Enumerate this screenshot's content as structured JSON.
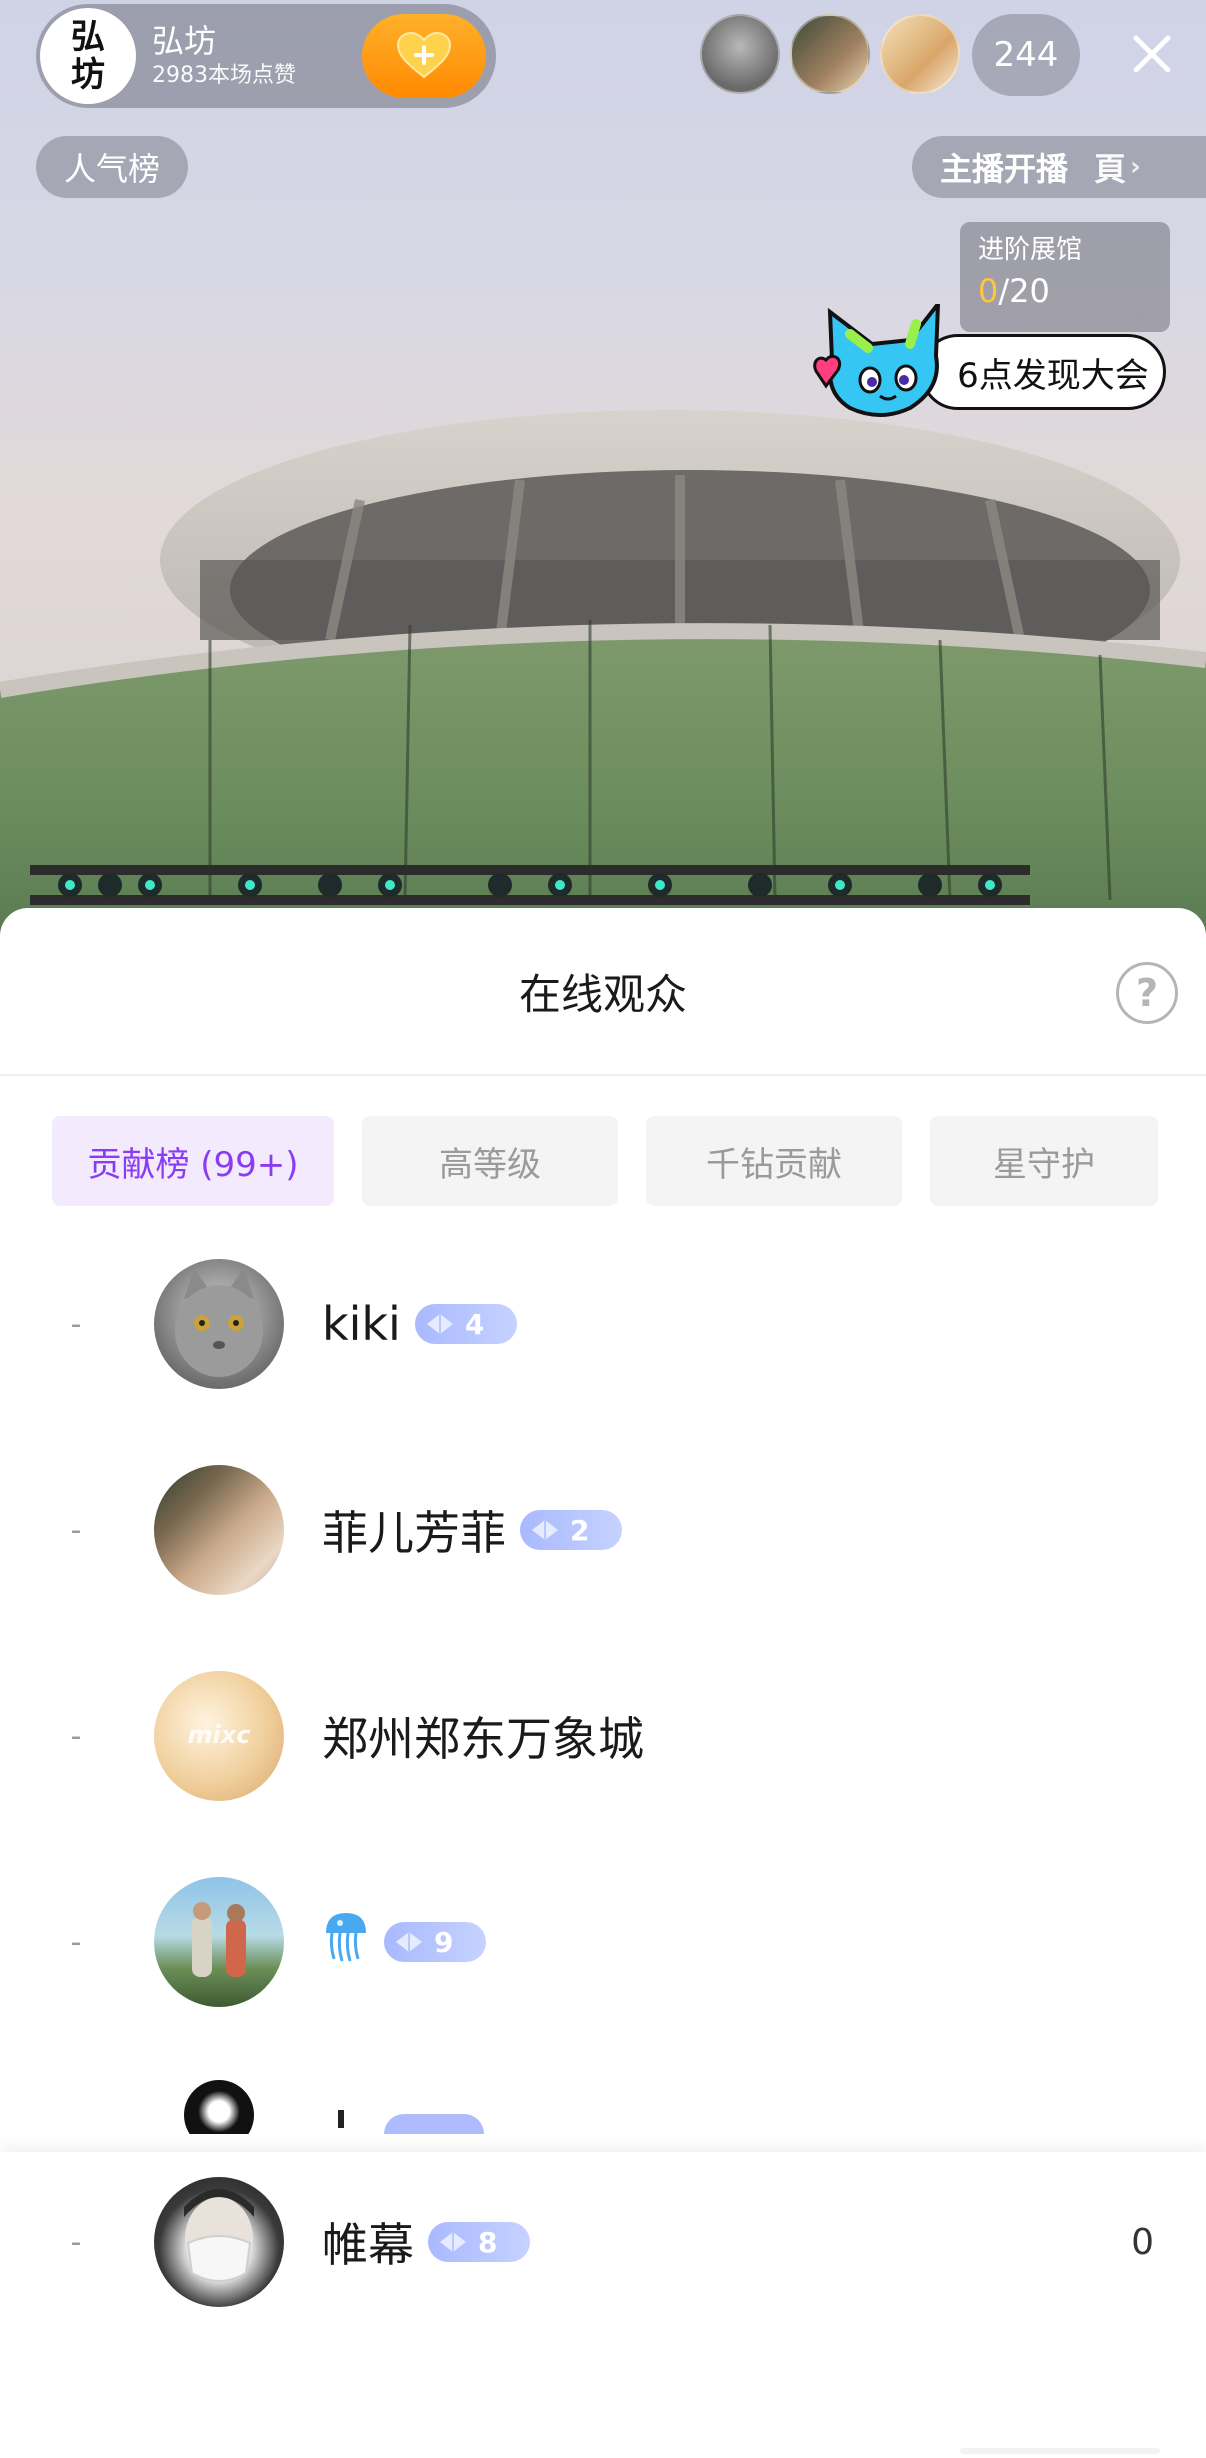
{
  "host": {
    "avatar_text": [
      "弘",
      "坊"
    ],
    "name": "弘坊",
    "likes": "2983本场点赞",
    "follow_icon": "heart-plus-icon"
  },
  "top_viewers": [
    "kiki",
    "菲儿芳菲",
    "郑州郑东万象城"
  ],
  "online_count": "244",
  "popularity_label": "人气榜",
  "anchor_start": {
    "label": "主播开播",
    "cut_text": "頁"
  },
  "gallery": {
    "title": "进阶展馆",
    "current": "0",
    "total": "/20"
  },
  "discover": {
    "label": "6点发现大会"
  },
  "sheet": {
    "title": "在线观众",
    "help": "?",
    "tabs": [
      {
        "label": "贡献榜 (99+)",
        "active": true
      },
      {
        "label": "高等级",
        "active": false
      },
      {
        "label": "千钻贡献",
        "active": false
      },
      {
        "label": "星守护",
        "active": false
      }
    ]
  },
  "viewers": [
    {
      "rank": "-",
      "name": "kiki",
      "level": "4"
    },
    {
      "rank": "-",
      "name": "菲儿芳菲",
      "level": "2"
    },
    {
      "rank": "-",
      "name": "郑州郑东万象城",
      "level": ""
    },
    {
      "rank": "-",
      "name": "🪼",
      "level": "9"
    }
  ],
  "self": {
    "rank": "-",
    "name": "帷幕",
    "level": "8",
    "score": "0"
  },
  "colors": {
    "accent_purple": "#8a3cf5",
    "level_badge": "#a9b9ff",
    "gold": "#ffc53d"
  }
}
